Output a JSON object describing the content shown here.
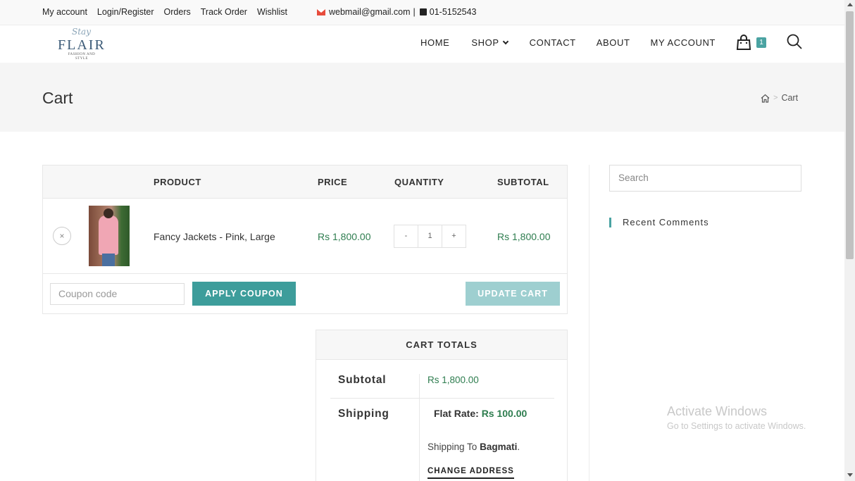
{
  "topbar": {
    "links": [
      "My account",
      "Login/Register",
      "Orders",
      "Track Order",
      "Wishlist"
    ],
    "email": "webmail@gmail.com",
    "separator": "|",
    "phone": "01-5152543"
  },
  "logo": {
    "script": "Stay",
    "brand": "FLAIR",
    "tagline_1": "FASHION AND",
    "tagline_2": "STYLE"
  },
  "nav": {
    "home": "HOME",
    "shop": "SHOP",
    "contact": "CONTACT",
    "about": "ABOUT",
    "my_account": "MY ACCOUNT",
    "cart_count": "1"
  },
  "page": {
    "title": "Cart",
    "breadcrumb_sep": ">",
    "breadcrumb_current": "Cart"
  },
  "cart": {
    "headers": {
      "product": "PRODUCT",
      "price": "PRICE",
      "quantity": "QUANTITY",
      "subtotal": "SUBTOTAL"
    },
    "item": {
      "remove": "×",
      "name": "Fancy Jackets - Pink, Large",
      "price": "Rs 1,800.00",
      "qty_minus": "-",
      "qty": "1",
      "qty_plus": "+",
      "subtotal": "Rs 1,800.00"
    },
    "coupon_placeholder": "Coupon code",
    "apply_coupon": "APPLY COUPON",
    "update_cart": "UPDATE CART"
  },
  "totals": {
    "heading": "CART TOTALS",
    "subtotal_label": "Subtotal",
    "subtotal_value": "Rs 1,800.00",
    "shipping_label": "Shipping",
    "flat_rate_label": "Flat Rate:",
    "flat_rate_value": "Rs 100.00",
    "shipping_to_prefix": "Shipping To",
    "shipping_to_region": "Bagmati",
    "shipping_to_suffix": ".",
    "change_address": "CHANGE ADDRESS"
  },
  "sidebar": {
    "search_placeholder": "Search",
    "recent_comments": "Recent Comments"
  },
  "watermark": {
    "line1": "Activate Windows",
    "line2": "Go to Settings to activate Windows."
  },
  "colors": {
    "accent": "#3d9d9b",
    "price_green": "#2e7d4f",
    "update_disabled": "#9ecfd0"
  }
}
